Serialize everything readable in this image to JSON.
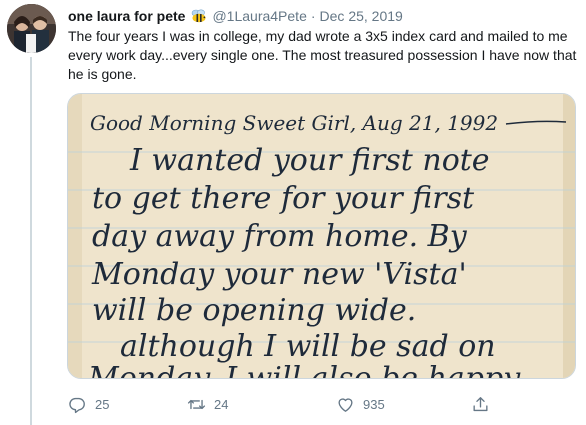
{
  "tweet": {
    "display_name": "one laura for pete",
    "handle": "@1Laura4Pete",
    "separator": "·",
    "date": "Dec 25, 2019",
    "text": "The four years I was in college, my dad wrote a 3x5 index card and mailed to me every work day...every single one. The most treasured possession I have now that he is gone.",
    "avatar_icon": "profile-photo-icon",
    "badge_icon": "bee-emoji-icon"
  },
  "media": {
    "note_lines": [
      "Good Morning Sweet Girl, Aug 21, 1992",
      "I wanted your first note",
      "to get there for your first",
      "day away from home. By",
      "Monday your new 'Vista'",
      "will be opening wide.",
      "although I will be sad on",
      "Monday, I will also be happy"
    ]
  },
  "actions": {
    "reply_count": "25",
    "retweet_count": "24",
    "like_count": "935",
    "reply_icon": "reply-icon",
    "retweet_icon": "retweet-icon",
    "like_icon": "heart-icon",
    "share_icon": "share-icon"
  },
  "colors": {
    "secondary_text": "#657786",
    "primary_text": "#14171a",
    "border": "#ccd6dd",
    "paper": "#f4ecd8",
    "ink": "#1e2a3a"
  }
}
